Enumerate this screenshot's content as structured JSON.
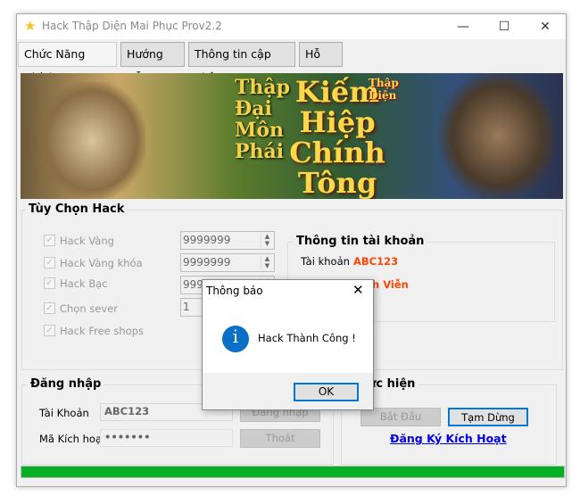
{
  "window": {
    "title": "Hack Thập Diện Mai Phục  Prov2.2",
    "icon": "star-icon"
  },
  "tabs": [
    {
      "label": "Chức Năng Chính"
    },
    {
      "label": "Hướng Dẫn"
    },
    {
      "label": "Thông tin cập nhật"
    },
    {
      "label": "Hỗ Trợ"
    }
  ],
  "banner": {
    "left_text": "Thập Đại Môn Phái",
    "center_text": "Kiếm Hiệp Chính Tông",
    "logo_text": "Thập Diện"
  },
  "hack_options": {
    "title": "Tùy Chọn Hack",
    "items": [
      {
        "label": "Hack Vàng",
        "checked": true,
        "value": "9999999"
      },
      {
        "label": "Hack Vàng khóa",
        "checked": true,
        "value": "9999999"
      },
      {
        "label": "Hack Bạc",
        "checked": true,
        "value": "9999999"
      },
      {
        "label": "Chọn sever",
        "checked": true,
        "value": "1"
      },
      {
        "label": "Hack Free shops",
        "checked": true
      }
    ]
  },
  "account_info": {
    "title": "Thông tin tài khoản",
    "account_label": "Tài khoản",
    "account_value": "ABC123",
    "duration_value": "Vĩnh Viễn",
    "accent": "#ff4500"
  },
  "login": {
    "title": "Đăng nhập",
    "account_label": "Tài Khoản",
    "account_value": "ABC123",
    "code_label": "Mã Kích hoạt",
    "code_value": "•••••••",
    "login_btn": "Đăng nhập",
    "exit_btn": "Thoát"
  },
  "execute": {
    "title": "Thực hiện",
    "start_btn": "Bắt Đầu",
    "pause_btn": "Tạm Dừng",
    "register_link": "Đăng Ký Kích Hoạt"
  },
  "progress": {
    "percent": 100,
    "color": "#06b025"
  },
  "dialog": {
    "title": "Thông báo",
    "message": "Hack Thành Công !",
    "ok": "OK",
    "icon": "info-icon"
  }
}
